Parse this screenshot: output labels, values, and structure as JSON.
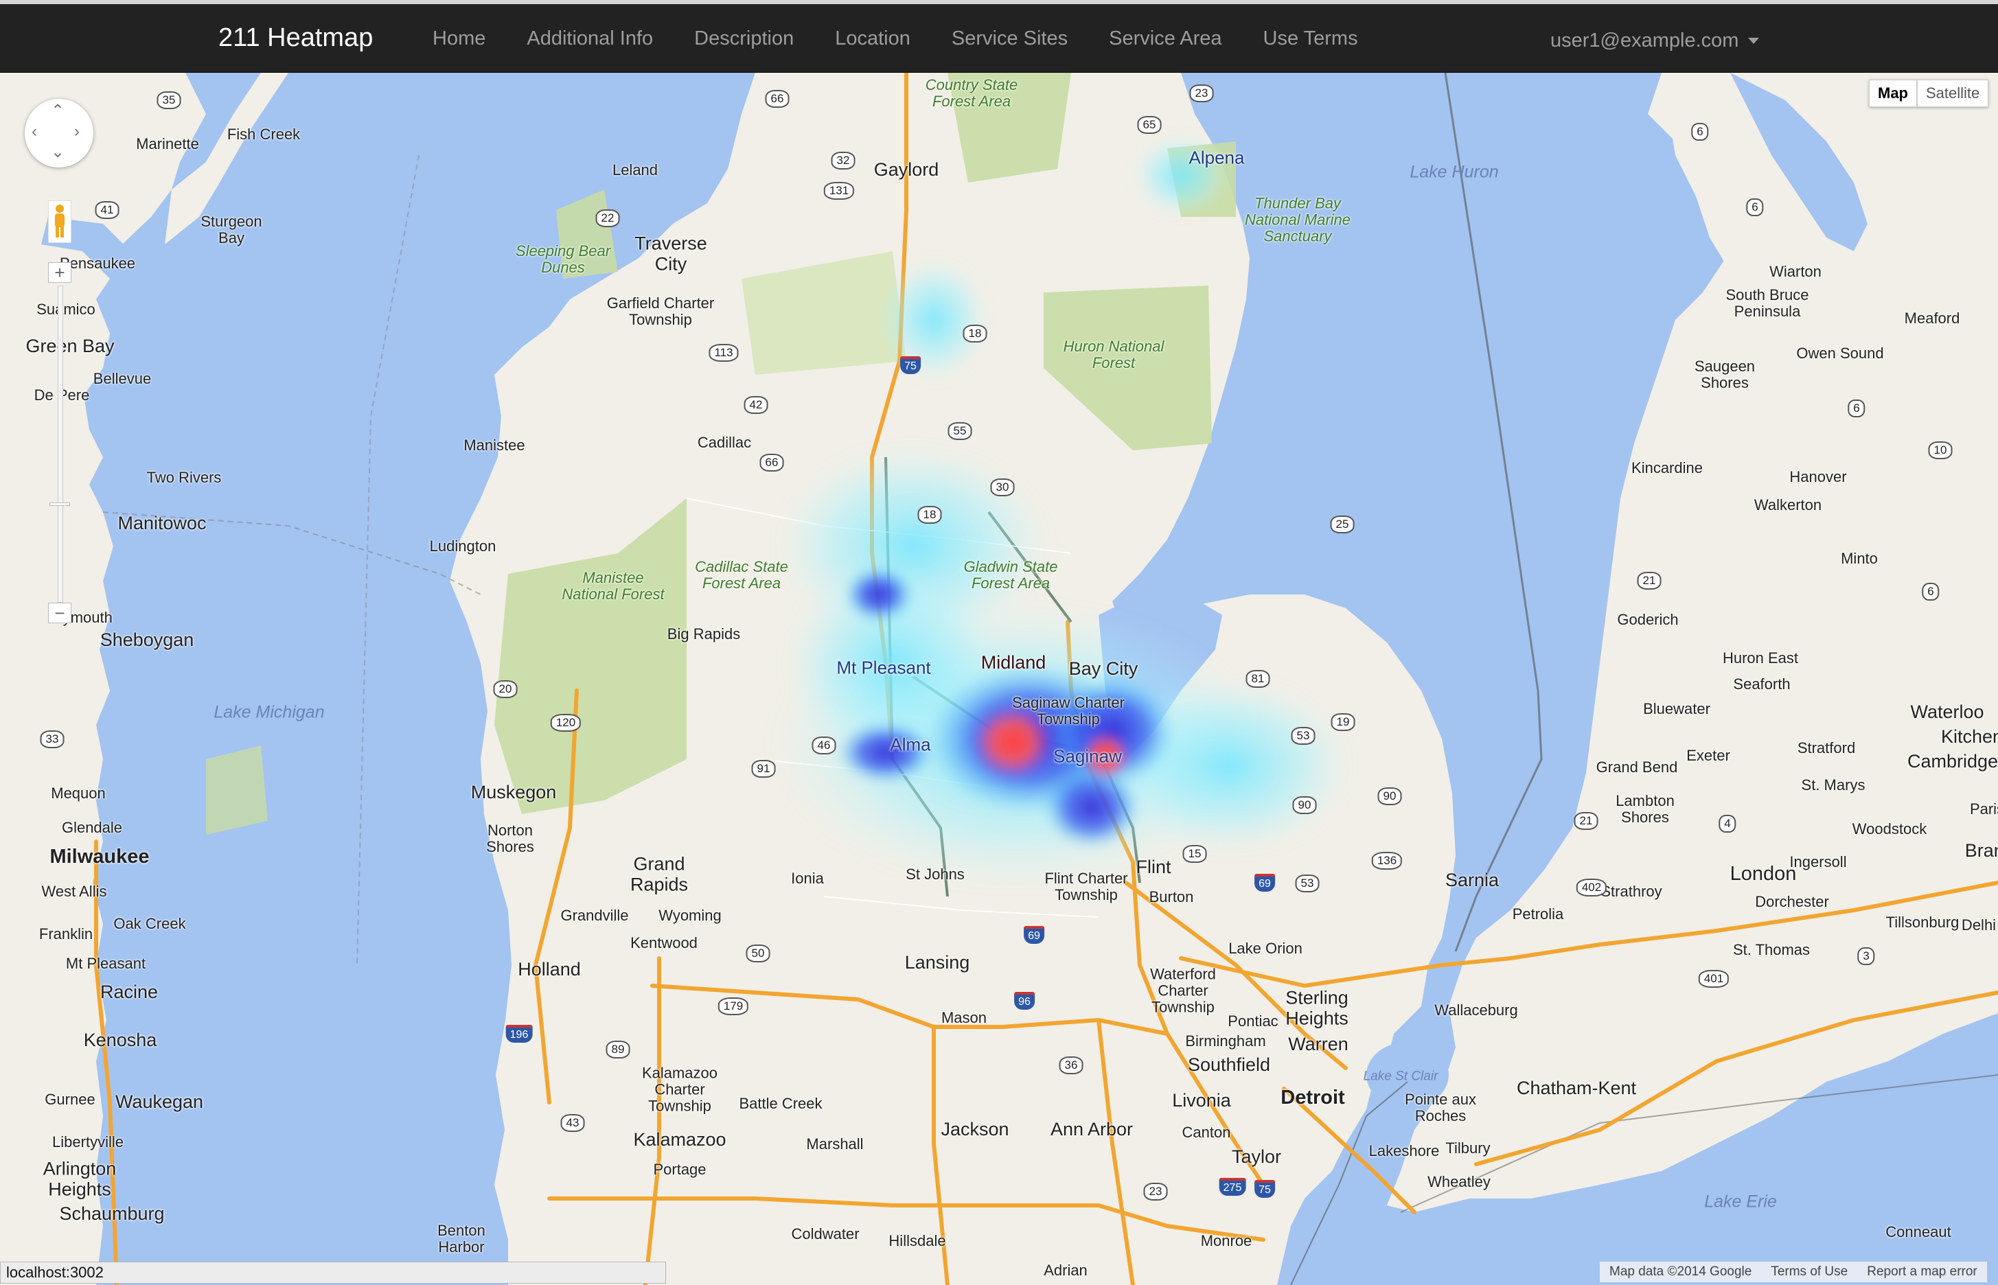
{
  "navbar": {
    "brand": "211 Heatmap",
    "links": [
      "Home",
      "Additional Info",
      "Description",
      "Location",
      "Service Sites",
      "Service Area",
      "Use Terms"
    ],
    "user": "user1@example.com"
  },
  "map": {
    "type_buttons": [
      "Map",
      "Satellite"
    ],
    "active_type": "Map",
    "colors": {
      "water": "#a3c3f1",
      "land": "#f1efe7",
      "park": "#c8dca4",
      "highway": "#f2a531",
      "heat_low": "#a8f0ff",
      "heat_mid": "#2a37d9",
      "heat_high": "#ff4a4a"
    },
    "labels": {
      "water": [
        "Lake Huron",
        "Lake Michigan",
        "Lake Erie",
        "Lake St Clair",
        "Thunder Bay National Marine Sanctuary"
      ],
      "parks": [
        "Country State Forest Area",
        "Sleeping Bear Dunes",
        "Huron National Forest",
        "Manistee National Forest",
        "Cadillac State Forest Area",
        "Gladwin State Forest Area"
      ],
      "cities": [
        "Fish Creek",
        "Marinette",
        "Leland",
        "Gaylord",
        "Alpena",
        "Sturgeon Bay",
        "Traverse City",
        "Garfield Charter Township",
        "Pensaukee",
        "Suamico",
        "Green Bay",
        "Bellevue",
        "De Pere",
        "Manistee",
        "Cadillac",
        "Two Rivers",
        "Manitowoc",
        "Ludington",
        "Plymouth",
        "Sheboygan",
        "Big Rapids",
        "Mt Pleasant",
        "Midland",
        "Bay City",
        "Saginaw Charter Township",
        "Saginaw",
        "Alma",
        "Muskegon",
        "Norton Shores",
        "Mequon",
        "Glendale",
        "Milwaukee",
        "West Allis",
        "Franklin",
        "Oak Creek",
        "Mt Pleasant",
        "Racine",
        "Kenosha",
        "Gurnee",
        "Waukegan",
        "Libertyville",
        "Arlington Heights",
        "Schaumburg",
        "Grand Rapids",
        "Grandville",
        "Wyoming",
        "Kentwood",
        "Holland",
        "Ionia",
        "St Johns",
        "Lansing",
        "Mason",
        "Flint",
        "Flint Charter Township",
        "Burton",
        "Lake Orion",
        "Waterford Charter Township",
        "Pontiac",
        "Sterling Heights",
        "Warren",
        "Birmingham",
        "Southfield",
        "Livonia",
        "Detroit",
        "Canton",
        "Taylor",
        "Ann Arbor",
        "Jackson",
        "Battle Creek",
        "Kalamazoo Charter Township",
        "Kalamazoo",
        "Portage",
        "Marshall",
        "Benton Harbor",
        "Coldwater",
        "Hillsdale",
        "Adrian",
        "Monroe",
        "Sarnia",
        "Petrolia",
        "Strathroy",
        "London",
        "Ingersoll",
        "Dorchester",
        "Woodstock",
        "Tillsonburg",
        "Delhi",
        "St. Thomas",
        "Chatham-Kent",
        "Wallaceburg",
        "Pointe aux Roches",
        "Lakeshore",
        "Tilbury",
        "Wheatley",
        "Conneaut",
        "Kincardine",
        "Hanover",
        "Walkerton",
        "Minto",
        "Goderich",
        "Huron East",
        "Seaforth",
        "Bluewater",
        "Waterloo",
        "Kitchener",
        "Cambridge",
        "Grand Bend",
        "Exeter",
        "Lambton Shores",
        "Stratford",
        "St. Marys",
        "Paris",
        "Brant",
        "Wiarton",
        "South Bruce Peninsula",
        "Meaford",
        "Owen Sound",
        "Saugeen Shores",
        "Lake Huron"
      ],
      "shields": [
        "35",
        "66",
        "23",
        "41",
        "65",
        "32",
        "131",
        "22",
        "18",
        "75",
        "113",
        "42",
        "55",
        "66",
        "30",
        "18",
        "25",
        "20",
        "120",
        "81",
        "33",
        "46",
        "91",
        "53",
        "19",
        "90",
        "90",
        "15",
        "136",
        "69",
        "53",
        "69",
        "50",
        "179",
        "96",
        "196",
        "89",
        "36",
        "43",
        "23",
        "275",
        "75",
        "402",
        "401",
        "3",
        "4",
        "21",
        "21",
        "6",
        "6",
        "10",
        "6",
        "6"
      ]
    },
    "heatmap": {
      "hotspots": [
        {
          "name": "Midland",
          "intensity": 1.0
        },
        {
          "name": "Bay City",
          "intensity": 0.85
        },
        {
          "name": "Saginaw",
          "intensity": 0.65
        }
      ]
    },
    "attribution": [
      "Map data ©2014 Google",
      "Terms of Use",
      "Report a map error"
    ],
    "zoom_in": "+",
    "zoom_out": "−"
  },
  "status_bar": "localhost:3002"
}
